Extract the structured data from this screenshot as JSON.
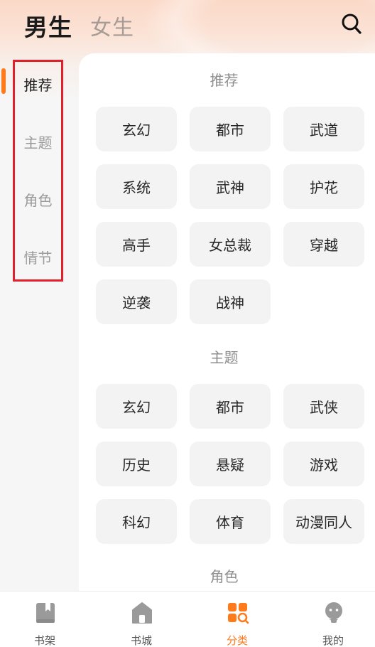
{
  "header": {
    "tabs": [
      {
        "label": "男生",
        "active": true
      },
      {
        "label": "女生",
        "active": false
      }
    ],
    "search_icon": "search-icon"
  },
  "sidebar": {
    "items": [
      {
        "label": "推荐",
        "active": true
      },
      {
        "label": "主题",
        "active": false
      },
      {
        "label": "角色",
        "active": false
      },
      {
        "label": "情节",
        "active": false
      }
    ]
  },
  "sections": [
    {
      "title": "推荐",
      "chips": [
        "玄幻",
        "都市",
        "武道",
        "系统",
        "武神",
        "护花",
        "高手",
        "女总裁",
        "穿越",
        "逆袭",
        "战神"
      ]
    },
    {
      "title": "主题",
      "chips": [
        "玄幻",
        "都市",
        "武侠",
        "历史",
        "悬疑",
        "游戏",
        "科幻",
        "体育",
        "动漫同人"
      ]
    },
    {
      "title": "角色",
      "chips": []
    }
  ],
  "bottom_nav": [
    {
      "label": "书架",
      "icon": "bookshelf-icon",
      "active": false
    },
    {
      "label": "书城",
      "icon": "home-icon",
      "active": false
    },
    {
      "label": "分类",
      "icon": "category-icon",
      "active": true
    },
    {
      "label": "我的",
      "icon": "profile-icon",
      "active": false
    }
  ],
  "colors": {
    "accent": "#ff7a1a",
    "highlight_box": "#e0202a",
    "chip_bg": "#f3f3f3"
  }
}
